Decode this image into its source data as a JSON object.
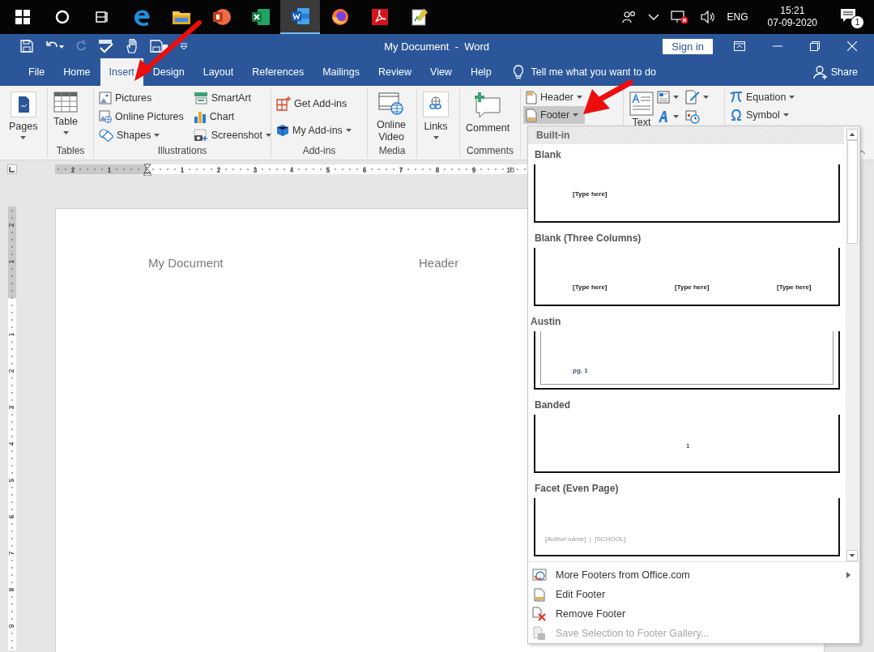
{
  "taskbar": {
    "apps": [
      {
        "kind": "start",
        "selected": false
      },
      {
        "kind": "search",
        "selected": false
      },
      {
        "kind": "task-view",
        "selected": false
      },
      {
        "kind": "edge",
        "selected": false
      },
      {
        "kind": "explorer",
        "selected": false
      },
      {
        "kind": "powerpoint",
        "selected": false
      },
      {
        "kind": "excel",
        "selected": false
      },
      {
        "kind": "word",
        "selected": true
      },
      {
        "kind": "firefox",
        "selected": false
      },
      {
        "kind": "acrobat",
        "selected": false
      },
      {
        "kind": "editor",
        "selected": false
      }
    ],
    "language": "ENG",
    "time": "15:21",
    "date": "07-09-2020",
    "notifications": "1"
  },
  "title_bar": {
    "title": "My Document  -  Word",
    "sign_in": "Sign in"
  },
  "tabs": [
    {
      "label": "File",
      "selected": false
    },
    {
      "label": "Home",
      "selected": false
    },
    {
      "label": "Insert",
      "selected": true
    },
    {
      "label": "Design",
      "selected": false
    },
    {
      "label": "Layout",
      "selected": false
    },
    {
      "label": "References",
      "selected": false
    },
    {
      "label": "Mailings",
      "selected": false
    },
    {
      "label": "Review",
      "selected": false
    },
    {
      "label": "View",
      "selected": false
    },
    {
      "label": "Help",
      "selected": false
    }
  ],
  "tell_me": "Tell me what you want to do",
  "share": "Share",
  "ribbon": [
    {
      "kind": "pages",
      "items": [
        {
          "label": "Pages",
          "menu": true
        }
      ]
    },
    {
      "kind": "tables",
      "label": "Tables",
      "items": [
        {
          "label": "Table",
          "menu": true
        }
      ]
    },
    {
      "kind": "illustrations",
      "label": "Illustrations",
      "items": [
        {
          "label": "Pictures"
        },
        {
          "label": "Online Pictures"
        },
        {
          "label": "Shapes",
          "menu": true
        },
        {
          "label": "SmartArt"
        },
        {
          "label": "Chart"
        },
        {
          "label": "Screenshot",
          "menu": true
        }
      ]
    },
    {
      "kind": "addins",
      "label": "Add-ins",
      "items": [
        {
          "label": "Get Add-ins"
        },
        {
          "label": "My Add-ins",
          "menu": true
        }
      ]
    },
    {
      "kind": "media",
      "label": "Media",
      "items": [
        {
          "label": "Online Video"
        }
      ]
    },
    {
      "kind": "links",
      "items": [
        {
          "label": "Links",
          "menu": true
        }
      ]
    },
    {
      "kind": "comments",
      "label": "Comments",
      "items": [
        {
          "label": "Comment"
        }
      ]
    },
    {
      "kind": "header-footer",
      "items": [
        {
          "label": "Header",
          "menu": true,
          "selected": false
        },
        {
          "label": "Footer",
          "menu": true,
          "selected": true
        }
      ]
    },
    {
      "kind": "text",
      "items": [
        {
          "label": "Text"
        }
      ]
    },
    {
      "kind": "symbols",
      "items": [
        {
          "label": "Equation",
          "menu": true
        },
        {
          "label": "Symbol",
          "menu": true
        }
      ]
    }
  ],
  "rulers": {
    "horizontal": [
      "2",
      "1",
      "1",
      "2",
      "3",
      "4",
      "5",
      "6",
      "7",
      "8",
      "9",
      "10"
    ],
    "vertical": [
      "2",
      "1",
      "1",
      "2",
      "3",
      "4",
      "5",
      "6",
      "7",
      "8",
      "9"
    ]
  },
  "document": {
    "header_left": "My Document",
    "header_right": "Header"
  },
  "footer_menu": {
    "section": "Built-in",
    "gallery": [
      {
        "name": "Blank",
        "kind": "blank",
        "fields": [
          "[Type here]"
        ]
      },
      {
        "name": "Blank (Three Columns)",
        "kind": "three-columns",
        "fields": [
          "[Type here]",
          "[Type here]",
          "[Type here]"
        ]
      },
      {
        "name": "Austin",
        "kind": "austin",
        "fields": [
          "pg. 1"
        ]
      },
      {
        "name": "Banded",
        "kind": "banded",
        "fields": [
          "1"
        ]
      },
      {
        "name": "Facet (Even Page)",
        "kind": "facet",
        "fields": [
          "[Author name]  |  [SCHOOL]"
        ]
      }
    ],
    "commands": [
      {
        "label": "More Footers from Office.com",
        "submenu": true,
        "disabled": false
      },
      {
        "label": "Edit Footer",
        "submenu": false,
        "disabled": false
      },
      {
        "label": "Remove Footer",
        "submenu": false,
        "disabled": false
      },
      {
        "label": "Save Selection to Footer Gallery...",
        "submenu": false,
        "disabled": true
      }
    ]
  }
}
